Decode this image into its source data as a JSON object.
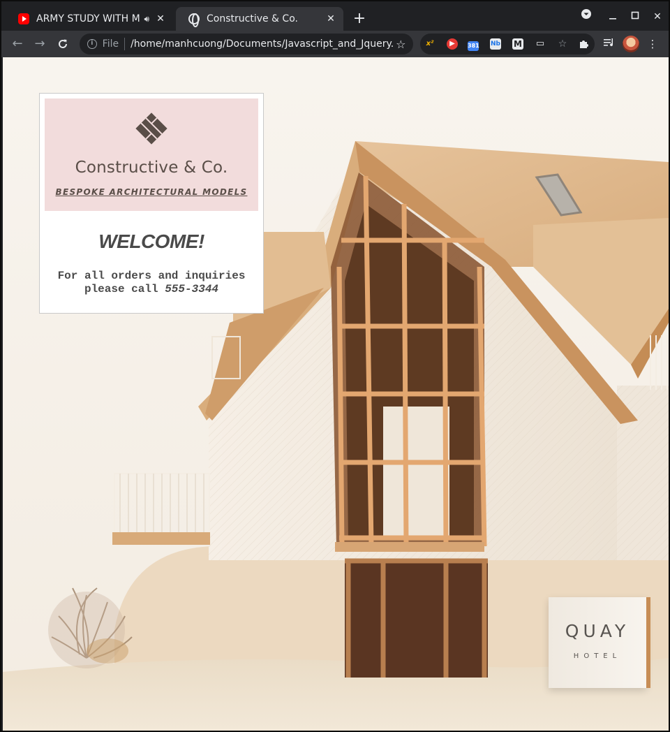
{
  "browser": {
    "tabs": [
      {
        "title": "ARMY STUDY WITH ME",
        "favicon": "youtube-icon",
        "audio": true
      },
      {
        "title": "Constructive & Co.",
        "favicon": "globe-icon",
        "active": true
      }
    ],
    "new_tab": "+",
    "address": {
      "scheme_label": "File",
      "url": "/home/manhcuong/Documents/Javascript_and_Jquery..."
    },
    "extension_badge": "381"
  },
  "page": {
    "brand_name": "Constructive & Co.",
    "tagline": "BESPOKE ARCHITECTURAL MODELS",
    "welcome": "WELCOME!",
    "contact_line1": "For all orders and inquiries",
    "contact_prefix": "please call",
    "phone": "555-3344",
    "sign": {
      "name": "QUAY",
      "subtitle": "HOTEL"
    }
  },
  "colors": {
    "logo_bg": "#f2dcdc",
    "text_dark": "#4a4a4a",
    "wood": "#d9b083",
    "page_bg": "#f7f2ea"
  }
}
